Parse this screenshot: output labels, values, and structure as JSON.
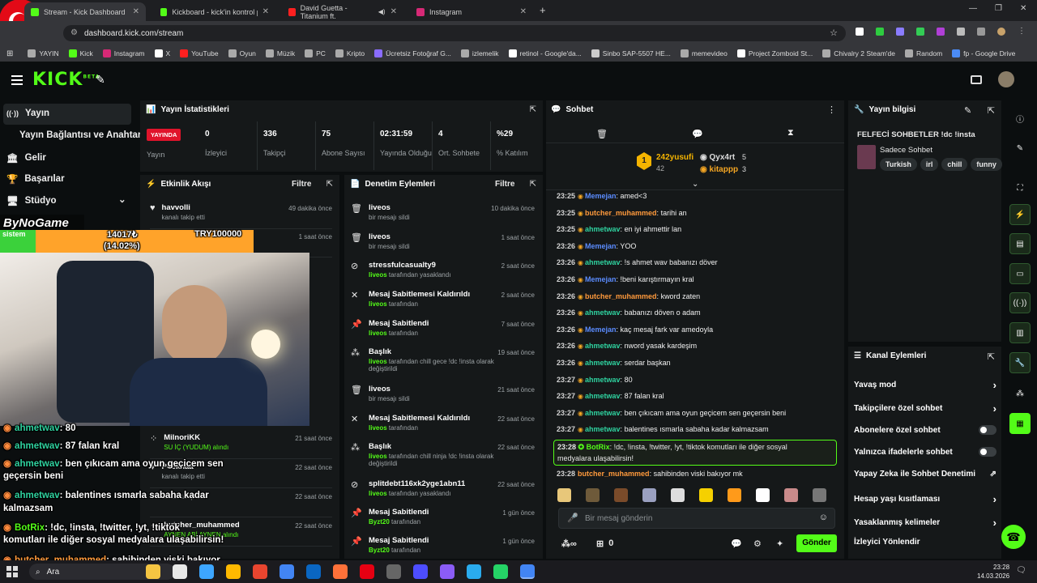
{
  "browser": {
    "tabs": [
      {
        "title": "Stream - Kick Dashboard",
        "fav": "#53fc18"
      },
      {
        "title": "Kickboard - kick'in kontrol pane",
        "fav": "#53fc18"
      },
      {
        "title": "David Guetta - Titanium ft.",
        "fav": "#ff2020"
      },
      {
        "title": "Instagram",
        "fav": "#d62976"
      }
    ],
    "url": "dashboard.kick.com/stream",
    "bookmarks": [
      "YAYIN",
      "Kick",
      "Instagram",
      "X",
      "YouTube",
      "Oyun",
      "Müzik",
      "PC",
      "Kripto",
      "Ücretsiz Fotoğraf G...",
      "izlemelik",
      "retinol - Google'da...",
      "Sinbo SAP-5507 HE...",
      "memevideo",
      "Project Zomboid St...",
      "Chivalry 2 Steam'de",
      "Random",
      "fp - Google Drive"
    ]
  },
  "header": {
    "logo": "KICK",
    "logo_sup": "BETA"
  },
  "nav": {
    "yayin": "Yayın",
    "baglanti": "Yayın Bağlantısı ve Anahtarı",
    "gelir": "Gelir",
    "basarilar": "Başarılar",
    "studyo": "Stüdyo"
  },
  "stats": {
    "title": "Yayın İstatistikleri",
    "live_badge": "YAYINDA",
    "live_label": "Yayın",
    "items": [
      {
        "value": "0",
        "label": "İzleyici"
      },
      {
        "value": "336",
        "label": "Takipçi"
      },
      {
        "value": "75",
        "label": "Abone Sayısı"
      },
      {
        "value": "02:31:59",
        "label": "Yayında Olduğu"
      },
      {
        "value": "4",
        "label": "Ort. Sohbete"
      },
      {
        "value": "%29",
        "label": "% Katılım"
      }
    ]
  },
  "activity": {
    "title": "Etkinlik Akışı",
    "filter": "Filtre",
    "items": [
      {
        "name": "havvolli",
        "sub": "kanalı takip etti",
        "time": "49 dakika önce"
      },
      {
        "name": "",
        "sub": "",
        "time": "1 saat önce"
      },
      {
        "name": "MilnoriKK",
        "sub": "SU İÇ (YUDUM) alındı",
        "time": "21 saat önce"
      },
      {
        "name": "Poekhaa",
        "sub": "kanalı takip etti",
        "time": "22 saat önce"
      },
      {
        "name": "",
        "sub": "kanalı takip etti",
        "time": "22 saat önce"
      },
      {
        "name": "butcher_muhammed",
        "sub": "AYNEN ABİ AYNEN alındı",
        "time": "22 saat önce"
      }
    ]
  },
  "moderation": {
    "title": "Denetim Eylemleri",
    "filter": "Filtre",
    "items": [
      {
        "title": "liveos",
        "sub": "bir mesajı sildi",
        "by": "",
        "time": "10 dakika önce",
        "icon": "trash"
      },
      {
        "title": "liveos",
        "sub": "bir mesajı sildi",
        "by": "",
        "time": "1 saat önce",
        "icon": "trash"
      },
      {
        "title": "stressfulcasualty9",
        "by": "liveos",
        "sub": "tarafından yasaklandı",
        "time": "2 saat önce",
        "icon": "ban"
      },
      {
        "title": "Mesaj Sabitlemesi Kaldırıldı",
        "by": "liveos",
        "sub": "tarafından",
        "time": "2 saat önce",
        "icon": "unpin"
      },
      {
        "title": "Mesaj Sabitlendi",
        "by": "liveos",
        "sub": "tarafından",
        "time": "7 saat önce",
        "icon": "pin"
      },
      {
        "title": "Başlık",
        "by": "liveos",
        "sub": "tarafından chill gece !dc !insta olarak değiştirildi",
        "time": "19 saat önce",
        "icon": "title"
      },
      {
        "title": "liveos",
        "sub": "bir mesajı sildi",
        "by": "",
        "time": "21 saat önce",
        "icon": "trash"
      },
      {
        "title": "Mesaj Sabitlemesi Kaldırıldı",
        "by": "liveos",
        "sub": "tarafından",
        "time": "22 saat önce",
        "icon": "unpin"
      },
      {
        "title": "Başlık",
        "by": "liveos",
        "sub": "tarafından chill ninja !dc !insta olarak değiştirildi",
        "time": "22 saat önce",
        "icon": "title"
      },
      {
        "title": "splitdebt116xk2yge1abn11",
        "by": "liveos",
        "sub": "tarafından yasaklandı",
        "time": "22 saat önce",
        "icon": "ban"
      },
      {
        "title": "Mesaj Sabitlendi",
        "by": "Byzt20",
        "sub": "tarafından",
        "time": "1 gün önce",
        "icon": "pin"
      },
      {
        "title": "Mesaj Sabitlendi",
        "by": "Byzt20",
        "sub": "tarafından",
        "time": "1 gün önce",
        "icon": "pin"
      }
    ]
  },
  "chat": {
    "title": "Sohbet",
    "leader1": {
      "rank": "1",
      "name": "242yusufi",
      "count": "42"
    },
    "leader2": {
      "name": "Qyx4rt",
      "count": "5"
    },
    "leader3": {
      "name": "kitappp",
      "count": "3"
    },
    "messages": [
      {
        "ts": "23:25",
        "user": "Memejan",
        "color": "#5b8cff",
        "text": "amed<3"
      },
      {
        "ts": "23:25",
        "user": "butcher_muhammed",
        "color": "#ff9a3c",
        "text": "tarihi an"
      },
      {
        "ts": "23:25",
        "user": "ahmetwav",
        "color": "#2fd3a0",
        "text": "en iyi ahmettir lan"
      },
      {
        "ts": "23:26",
        "user": "Memejan",
        "color": "#5b8cff",
        "text": "YOO"
      },
      {
        "ts": "23:26",
        "user": "ahmetwav",
        "color": "#2fd3a0",
        "text": "!s ahmet wav babanızı döver"
      },
      {
        "ts": "23:26",
        "user": "Memejan",
        "color": "#5b8cff",
        "text": "!beni karıştırmayın kral"
      },
      {
        "ts": "23:26",
        "user": "butcher_muhammed",
        "color": "#ff9a3c",
        "text": "kword zaten"
      },
      {
        "ts": "23:26",
        "user": "ahmetwav",
        "color": "#2fd3a0",
        "text": "babanızı döven o adam"
      },
      {
        "ts": "23:26",
        "user": "Memejan",
        "color": "#5b8cff",
        "text": "kaç mesaj fark var amedoyla"
      },
      {
        "ts": "23:26",
        "user": "ahmetwav",
        "color": "#2fd3a0",
        "text": "nword yasak kardeşim"
      },
      {
        "ts": "23:26",
        "user": "ahmetwav",
        "color": "#2fd3a0",
        "text": "serdar başkan"
      },
      {
        "ts": "23:27",
        "user": "ahmetwav",
        "color": "#2fd3a0",
        "text": "80"
      },
      {
        "ts": "23:27",
        "user": "ahmetwav",
        "color": "#2fd3a0",
        "text": "87 falan kral"
      },
      {
        "ts": "23:27",
        "user": "ahmetwav",
        "color": "#2fd3a0",
        "text": "ben çıkıcam ama oyun geçicem sen geçersin beni"
      },
      {
        "ts": "23:27",
        "user": "ahmetwav",
        "color": "#2fd3a0",
        "text": "balentines ısmarla sabaha kadar kalmazsam"
      }
    ],
    "bot": {
      "ts": "23:28",
      "user": "BotRix",
      "line1": "!dc, !insta, !twitter, !yt, !tiktok komutları ile diğer sosyal",
      "line2": "medyalara ulaşabilirsin!"
    },
    "last": {
      "ts": "23:28",
      "user": "butcher_muhammed",
      "text": "sahibinden viski bakıyor mk"
    },
    "placeholder": "Bir mesaj gönderin",
    "viewer_count": "0",
    "send": "Gönder"
  },
  "streaminfo": {
    "title": "Yayın bilgisi",
    "stream_title": "FELFECİ SOHBETLER !dc !insta",
    "category": "Sadece Sohbet",
    "tags": [
      "Turkish",
      "irl",
      "chill",
      "funny"
    ]
  },
  "channel_actions": {
    "title": "Kanal Eylemleri",
    "items": [
      {
        "label": "Yavaş mod",
        "ctrl": "arrow"
      },
      {
        "label": "Takipçilere özel sohbet",
        "ctrl": "arrow"
      },
      {
        "label": "Abonelere özel sohbet",
        "ctrl": "toggle"
      },
      {
        "label": "Yalnızca ifadelerle sohbet",
        "ctrl": "toggle"
      },
      {
        "label": "Yapay Zeka ile Sohbet Denetimi",
        "ctrl": "ext"
      },
      {
        "label": "Hesap yaşı kısıtlaması",
        "ctrl": "arrow"
      },
      {
        "label": "Yasaklanmış kelimeler",
        "ctrl": "arrow"
      },
      {
        "label": "İzleyici Yönlendir",
        "ctrl": "none"
      }
    ]
  },
  "overlay": {
    "name": "ByNoGame",
    "goal_label": "sistem",
    "goal_value": "14017₺",
    "goal_pct": "(14.02%)",
    "goal_target": "TRY100000",
    "goal_fraction": 0.1402,
    "chat": [
      {
        "user": "ahmetwav",
        "text": ": 80"
      },
      {
        "user": "ahmetwav",
        "text": ": 87 falan kral"
      },
      {
        "user": "ahmetwav",
        "text": ": ben çıkıcam ama oyun geçicem sen"
      },
      {
        "user": "",
        "text": "geçersin beni"
      },
      {
        "user": "ahmetwav",
        "text": ": balentines ısmarla sabaha kadar"
      },
      {
        "user": "",
        "text": "kalmazsam"
      },
      {
        "user": "BotRix",
        "text": ": !dc, !insta, !twitter, !yt, !tiktok"
      },
      {
        "user": "",
        "text": "komutları ile diğer sosyal medyalara ulaşabilirsin!"
      },
      {
        "user": "butcher_muhammed",
        "text": ": sahibinden viski bakıyor"
      }
    ]
  },
  "taskbar": {
    "search": "Ara",
    "time": "23:28",
    "date": "14.03.2026"
  },
  "colors": {
    "accent": "#53fc18",
    "live": "#e0142b",
    "panel": "#151819",
    "bg": "#0b0e0f"
  }
}
